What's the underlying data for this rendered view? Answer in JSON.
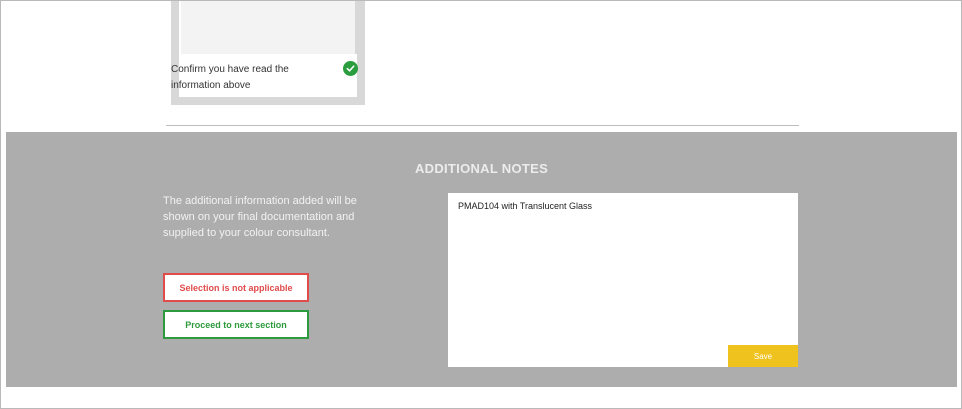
{
  "confirm_card": {
    "label": "Confirm you have read the information above",
    "status_icon": "check-circle-icon",
    "status_color": "#2a9d3e"
  },
  "additional_notes": {
    "title": "ADDITIONAL NOTES",
    "help_text": "The additional information added will be shown on your final documentation and supplied to your colour consultant.",
    "not_applicable_label": "Selection is not applicable",
    "proceed_label": "Proceed to next section",
    "notes_value": "PMAD104 with Translucent Glass",
    "save_label": "Save"
  },
  "colors": {
    "section_background": "#adadad",
    "save_button": "#f0c21d",
    "not_applicable_accent": "#e04b4b",
    "proceed_accent": "#2d9a3d"
  }
}
